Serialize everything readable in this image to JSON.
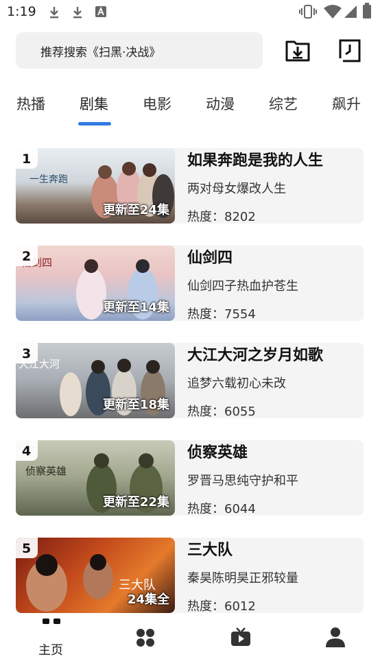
{
  "status_bar": {
    "time": "1:19",
    "left_icons": [
      "download-icon",
      "download-icon",
      "a-box-icon"
    ],
    "right_icons": [
      "vibrate-icon",
      "wifi-icon",
      "signal-icon",
      "battery-icon"
    ]
  },
  "search": {
    "placeholder_text": "推荐搜索《扫黑·决战》"
  },
  "header_buttons": [
    "download-folder-icon",
    "history-icon"
  ],
  "tabs": [
    {
      "label": "热播"
    },
    {
      "label": "剧集"
    },
    {
      "label": "电影"
    },
    {
      "label": "动漫"
    },
    {
      "label": "综艺"
    },
    {
      "label": "飙升"
    }
  ],
  "active_tab": "剧集",
  "accent_color": "#2f7be0",
  "items": [
    {
      "rank": "1",
      "badge": "更新至24集",
      "title": "如果奔跑是我的人生",
      "desc": "两对母女爆改人生",
      "heat": "热度：8202"
    },
    {
      "rank": "2",
      "badge": "更新至14集",
      "title": "仙剑四",
      "desc": "仙剑四子热血护苍生",
      "heat": "热度：7554"
    },
    {
      "rank": "3",
      "badge": "更新至18集",
      "title": "大江大河之岁月如歌",
      "desc": "追梦六载初心未改",
      "heat": "热度：6055"
    },
    {
      "rank": "4",
      "badge": "更新至22集",
      "title": "侦察英雄",
      "desc": "罗晋马思纯守护和平",
      "heat": "热度：6044"
    },
    {
      "rank": "5",
      "badge": "24集全",
      "title": "三大队",
      "desc": "秦昊陈明昊正邪较量",
      "heat": "热度：6012"
    }
  ],
  "bottom_nav": [
    {
      "label": "主页",
      "icon": "home-icon"
    },
    {
      "label": "",
      "icon": "apps-icon"
    },
    {
      "label": "",
      "icon": "tv-icon"
    },
    {
      "label": "",
      "icon": "profile-icon"
    }
  ]
}
